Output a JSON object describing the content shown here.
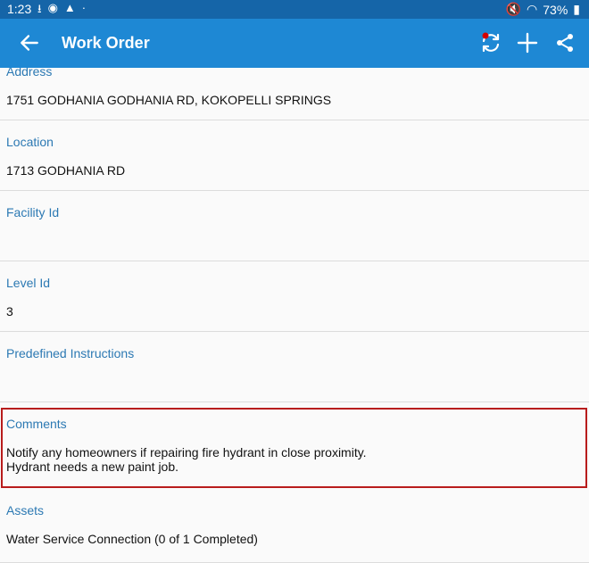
{
  "status_bar": {
    "time": "1:23",
    "battery": "73%"
  },
  "app_bar": {
    "title": "Work Order"
  },
  "fields": {
    "address": {
      "label": "Address",
      "value": "1751 GODHANIA GODHANIA RD, KOKOPELLI SPRINGS"
    },
    "location": {
      "label": "Location",
      "value": "1713 GODHANIA RD"
    },
    "facility_id": {
      "label": "Facility Id",
      "value": ""
    },
    "level_id": {
      "label": "Level Id",
      "value": "3"
    },
    "predefined_instructions": {
      "label": "Predefined Instructions",
      "value": ""
    },
    "comments": {
      "label": "Comments",
      "line1": "Notify any homeowners if repairing fire hydrant in close proximity.",
      "line2": "Hydrant needs a new paint job."
    },
    "assets": {
      "label": "Assets",
      "value": "Water Service Connection (0 of 1 Completed)"
    }
  },
  "colors": {
    "app_bar": "#1e88d4",
    "status_bar": "#1565a8",
    "label": "#2c79b3",
    "highlight": "#b81c1c"
  }
}
